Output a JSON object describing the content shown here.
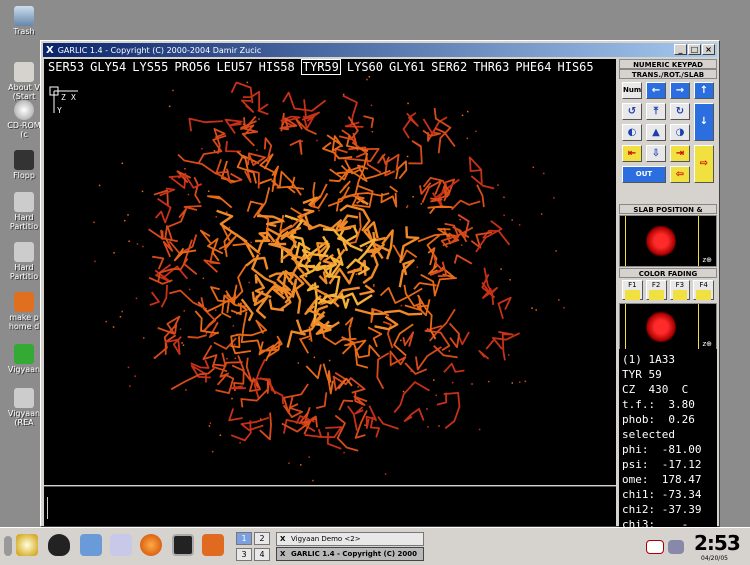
{
  "desktop": {
    "icons": [
      {
        "label": "Trash"
      },
      {
        "label": "About V (Start"
      },
      {
        "label": "CD-ROM (c"
      },
      {
        "label": "Flopp"
      },
      {
        "label": "Hard Partitio"
      },
      {
        "label": "Hard Partitio"
      },
      {
        "label": "make p home d"
      },
      {
        "label": "Vigyaan"
      },
      {
        "label": "Vigyaan (REA"
      }
    ]
  },
  "window": {
    "title": "GARLIC 1.4 - Copyright (C) 2000-2004 Damir Zucic",
    "controls": [
      "_",
      "□",
      "×"
    ]
  },
  "sequence": {
    "residues": [
      "SER53",
      "GLY54",
      "LYS55",
      "PRO56",
      "LEU57",
      "HIS58",
      "TYR59",
      "LYS60",
      "GLY61",
      "SER62",
      "THR63",
      "PHE64",
      "HIS65"
    ],
    "selected_index": 6
  },
  "viewer": {
    "axis_labels": [
      "Z",
      "X",
      "Y"
    ]
  },
  "panel": {
    "numeric_keypad_title": "NUMERIC KEYPAD",
    "numeric_keypad_sub": "TRANS./ROT./SLAB",
    "num_label": "Num",
    "out_label": "OUT",
    "slab_title": "SLAB POSITION & WIDTH",
    "color_fading_title": "COLOR FADING",
    "fade_buttons": [
      "F1",
      "F2",
      "F3",
      "F4"
    ]
  },
  "info": {
    "lines": [
      "(1) 1A33",
      "TYR 59",
      "CZ  430  C",
      "t.f.:  3.80",
      "phob:  0.26",
      "selected",
      "phi:  -81.00",
      "psi:  -17.12",
      "ome:  178.47",
      "chi1: -73.34",
      "chi2: -37.39",
      "chi3:    -"
    ]
  },
  "taskbar": {
    "pager": [
      "1",
      "2",
      "3",
      "4"
    ],
    "tasks": [
      {
        "label": "Vigyaan Demo <2>",
        "active": false
      },
      {
        "label": "GARLIC 1.4 - Copyright (C) 2000",
        "active": true
      }
    ],
    "clock": "2:53",
    "date": "04/20/05"
  },
  "colors": {
    "desktop_bg": "#8c8c8c",
    "window_bg": "#d6d3ce",
    "titlebar": "#0a246a",
    "viewer_bg": "#000000",
    "molecule_outer": "#c83018",
    "molecule_mid": "#e86a18",
    "molecule_inner": "#f6b038"
  }
}
